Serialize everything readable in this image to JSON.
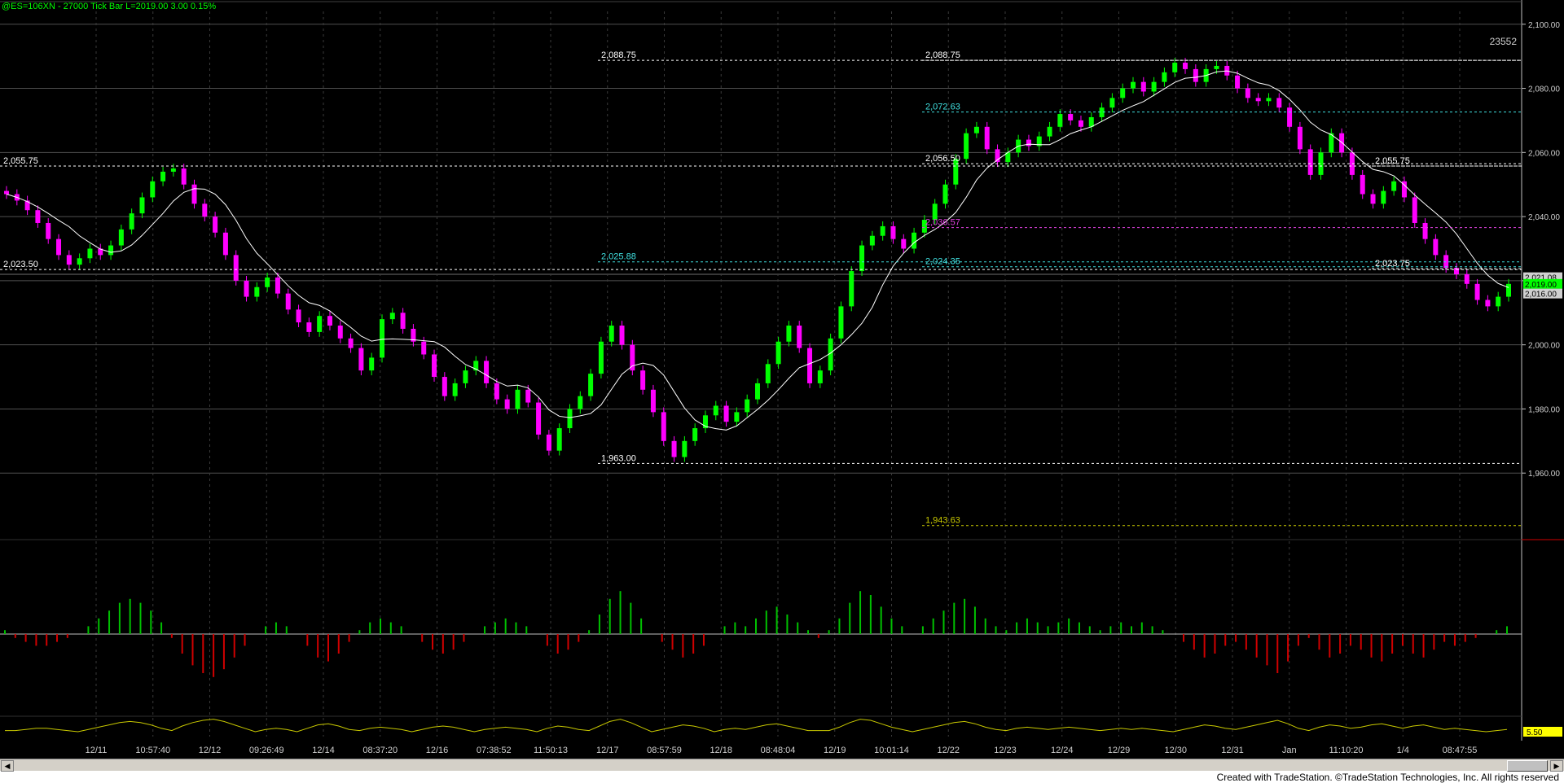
{
  "header": {
    "title": "@ES=106XN - 27000 Tick Bar  L=2019.00  3.00  0.15%"
  },
  "footer": {
    "credit": "Created with TradeStation. ©TradeStation Technologies, Inc. All rights reserved"
  },
  "colors": {
    "up": "#00ff00",
    "down": "#ff00ff",
    "osc_up": "#00c000",
    "osc_down": "#d00000",
    "ma": "#ffffff",
    "vol": "#c8c800",
    "cyan": "#40e0e0",
    "magenta": "#e040e0"
  },
  "scroll": {
    "left_icon": "arrow-left-icon",
    "right_icon": "arrow-right-icon"
  },
  "chart_data": [
    {
      "type": "candlestick",
      "title": "@ES=106XN - 27000 Tick Bar  L=2019.00  3.00  0.15%",
      "ylim": [
        1940,
        2104
      ],
      "y_ticks": [
        "2,100.00",
        "2,080.00",
        "2,060.00",
        "2,040.00",
        "2,020.00",
        "2,000.00",
        "1,980.00",
        "1,960.00"
      ],
      "y_tick_values": [
        2100,
        2080,
        2060,
        2040,
        2020,
        2000,
        1980,
        1960
      ],
      "x_ticks": [
        "12/11",
        "10:57:40",
        "12/12",
        "09:26:49",
        "12/14",
        "08:37:20",
        "12/16",
        "07:38:52",
        "11:50:13",
        "12/17",
        "08:57:59",
        "12/18",
        "08:48:04",
        "12/19",
        "10:01:14",
        "12/22",
        "12/23",
        "12/24",
        "12/29",
        "12/30",
        "12/31",
        "Jan",
        "11:10:20",
        "1/4",
        "08:47:55"
      ],
      "last_price_labels": [
        "2,021.08",
        "2,019.00",
        "2,016.00"
      ],
      "last_price_values": [
        2021.08,
        2019.0,
        2016.0
      ],
      "bar_count": "23552",
      "close": [
        2047,
        2045,
        2042,
        2038,
        2033,
        2028,
        2025,
        2027,
        2030,
        2028,
        2031,
        2036,
        2041,
        2046,
        2051,
        2054,
        2055,
        2050,
        2044,
        2040,
        2035,
        2028,
        2020,
        2015,
        2018,
        2021,
        2016,
        2011,
        2007,
        2004,
        2009,
        2006,
        2002,
        1999,
        1992,
        1996,
        2008,
        2010,
        2005,
        2001,
        1997,
        1990,
        1984,
        1988,
        1992,
        1995,
        1988,
        1983,
        1980,
        1986,
        1982,
        1972,
        1967,
        1974,
        1980,
        1984,
        1991,
        2001,
        2006,
        2000,
        1992,
        1986,
        1979,
        1970,
        1965,
        1970,
        1974,
        1978,
        1981,
        1976,
        1979,
        1983,
        1988,
        1994,
        2001,
        2006,
        1999,
        1988,
        1992,
        2002,
        2012,
        2023,
        2031,
        2034,
        2037,
        2033,
        2030,
        2035,
        2039,
        2044,
        2050,
        2058,
        2066,
        2068,
        2061,
        2057,
        2060,
        2064,
        2062,
        2065,
        2068,
        2072,
        2070,
        2068,
        2071,
        2074,
        2077,
        2080,
        2082,
        2079,
        2082,
        2085,
        2088,
        2086,
        2082,
        2086,
        2087,
        2084,
        2080,
        2077,
        2076,
        2077,
        2074,
        2068,
        2061,
        2053,
        2060,
        2066,
        2060,
        2053,
        2047,
        2044,
        2048,
        2051,
        2046,
        2038,
        2033,
        2028,
        2024,
        2022,
        2019,
        2014,
        2012,
        2015,
        2019
      ],
      "indicators": {
        "oscillator_amplitude": [
          1,
          -1,
          -2,
          -3,
          -3,
          -2,
          -1,
          0,
          2,
          4,
          6,
          8,
          9,
          8,
          6,
          3,
          -1,
          -5,
          -8,
          -10,
          -11,
          -9,
          -6,
          -3,
          0,
          2,
          3,
          2,
          0,
          -3,
          -6,
          -7,
          -5,
          -2,
          1,
          3,
          4,
          3,
          2,
          0,
          -2,
          -4,
          -5,
          -4,
          -2,
          0,
          2,
          3,
          4,
          3,
          2,
          0,
          -3,
          -5,
          -4,
          -2,
          1,
          5,
          9,
          11,
          8,
          4,
          0,
          -2,
          -4,
          -6,
          -5,
          -3,
          0,
          2,
          3,
          2,
          4,
          6,
          7,
          5,
          3,
          1,
          -1,
          1,
          4,
          8,
          11,
          10,
          7,
          4,
          2,
          0,
          2,
          4,
          6,
          8,
          9,
          7,
          4,
          2,
          1,
          3,
          4,
          3,
          2,
          3,
          4,
          3,
          2,
          1,
          2,
          3,
          2,
          3,
          2,
          1,
          0,
          -2,
          -4,
          -6,
          -5,
          -3,
          -2,
          -4,
          -6,
          -8,
          -10,
          -7,
          -3,
          -1,
          -4,
          -6,
          -5,
          -3,
          -4,
          -6,
          -7,
          -5,
          -3,
          -5,
          -6,
          -4,
          -2,
          -3,
          -2,
          -1,
          0,
          1,
          2
        ]
      },
      "levels": [
        {
          "label": "2,088.75",
          "value": 2088.75,
          "color": "#ffffff"
        },
        {
          "label": "2,088.75",
          "value": 2088.75,
          "color": "#ffffff"
        },
        {
          "label": "2,072.63",
          "value": 2072.63,
          "color": "#40e0e0"
        },
        {
          "label": "2,055.75",
          "value": 2055.75,
          "color": "#ffffff"
        },
        {
          "label": "2,056.50",
          "value": 2056.5,
          "color": "#ffffff"
        },
        {
          "label": "2,055.75",
          "value": 2055.75,
          "color": "#ffffff"
        },
        {
          "label": "2,036.57",
          "value": 2036.57,
          "color": "#e040e0"
        },
        {
          "label": "2,025.88",
          "value": 2025.88,
          "color": "#40e0e0"
        },
        {
          "label": "2,024.35",
          "value": 2024.35,
          "color": "#40e0e0"
        },
        {
          "label": "2,023.75",
          "value": 2023.75,
          "color": "#ffffff"
        },
        {
          "label": "2,023.50",
          "value": 2023.5,
          "color": "#ffffff"
        },
        {
          "label": "1,963.00",
          "value": 1963.0,
          "color": "#ffffff"
        },
        {
          "label": "1,943.63",
          "value": 1943.63,
          "color": "#c8c800"
        }
      ],
      "volume_label": "5.50",
      "volume_value": 5.5
    }
  ]
}
